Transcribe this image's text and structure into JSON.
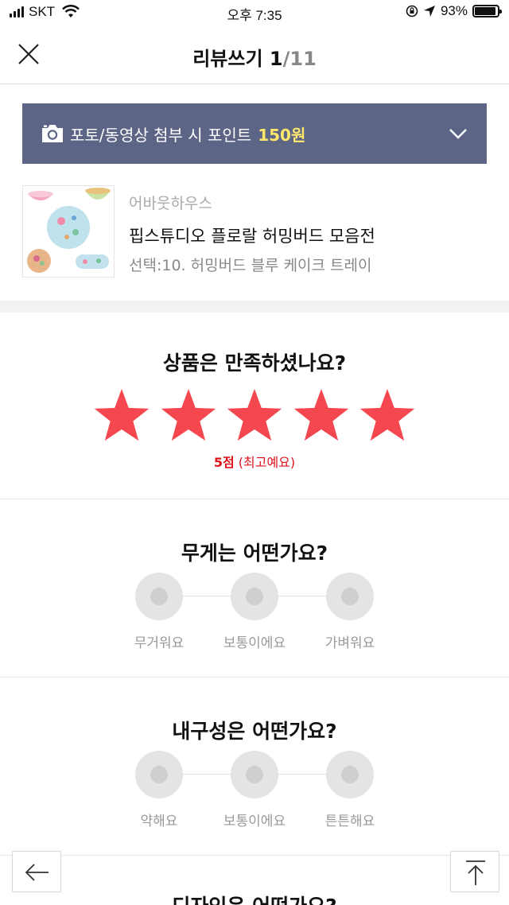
{
  "status_bar": {
    "carrier": "SKT",
    "time": "오후 7:35",
    "battery": "93%",
    "battery_level": 0.93
  },
  "header": {
    "title": "리뷰쓰기",
    "current": "1",
    "total": "/11"
  },
  "banner": {
    "text": "포토/동영상 첨부 시 포인트",
    "points": "150원"
  },
  "product": {
    "brand": "어바웃하우스",
    "name": "핍스튜디오 플로랄 허밍버드 모음전",
    "option": "선택:10. 허밍버드 블루 케이크 트레이"
  },
  "rating": {
    "question": "상품은 만족하셨나요?",
    "stars": 5,
    "score_label": "5점",
    "score_desc": "(최고예요)",
    "star_color": "#f5474f"
  },
  "weight": {
    "question": "무게는 어떤가요?",
    "options": [
      "무거워요",
      "보통이에요",
      "가벼워요"
    ]
  },
  "durability": {
    "question": "내구성은 어떤가요?",
    "options": [
      "약해요",
      "보통이에요",
      "튼튼해요"
    ]
  },
  "design": {
    "question": "디자인은 어떤가요?"
  },
  "colors": {
    "banner_bg": "#5c6585",
    "points": "#ffe76b",
    "score": "#e0131c"
  }
}
